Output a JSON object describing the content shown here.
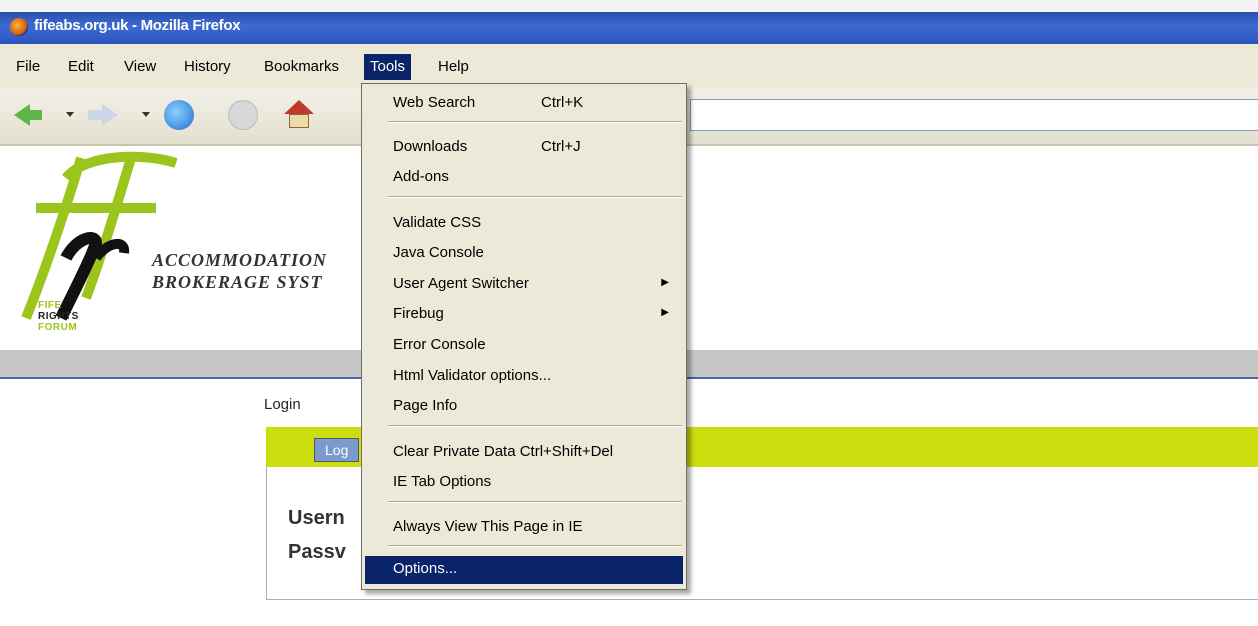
{
  "window": {
    "title": "fifeabs.org.uk - Mozilla Firefox"
  },
  "menubar": [
    {
      "label": "File"
    },
    {
      "label": "Edit"
    },
    {
      "label": "View"
    },
    {
      "label": "History"
    },
    {
      "label": "Bookmarks"
    },
    {
      "label": "Tools"
    },
    {
      "label": "Help"
    }
  ],
  "tools_menu": {
    "items": [
      {
        "label": "Web Search",
        "shortcut": "Ctrl+K"
      },
      {
        "label": "Downloads",
        "shortcut": "Ctrl+J"
      },
      {
        "label": "Add-ons"
      },
      {
        "label": "Validate CSS"
      },
      {
        "label": "Java Console"
      },
      {
        "label": "User Agent Switcher",
        "submenu": true
      },
      {
        "label": "Firebug",
        "submenu": true
      },
      {
        "label": "Error Console"
      },
      {
        "label": "Html Validator options..."
      },
      {
        "label": "Page Info"
      },
      {
        "label": "Clear Private Data Ctrl+Shift+Del"
      },
      {
        "label": "IE Tab Options"
      },
      {
        "label": "Always View This Page in IE"
      },
      {
        "label": "Options...",
        "selected": true
      }
    ]
  },
  "logo": {
    "line1": "FIFE",
    "line2": "RIGHTS",
    "line3": "FORUM"
  },
  "site": {
    "title_line1": "ACCOMMODATION",
    "title_line2": "BROKERAGE SYST"
  },
  "page": {
    "breadcrumb": "Login",
    "login_tab": "Log",
    "username_label": "Usern",
    "password_label": "Passv"
  },
  "colors": {
    "menu_highlight": "#0a246a",
    "login_bar": "#cbde0e",
    "logo_green": "#9bc41c"
  }
}
